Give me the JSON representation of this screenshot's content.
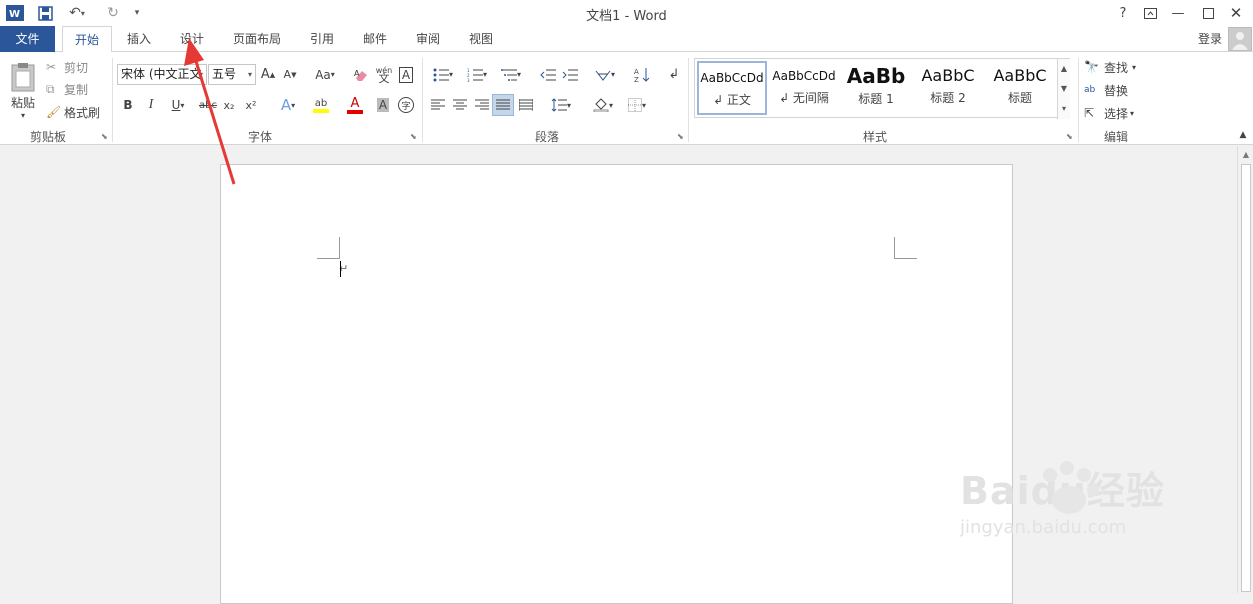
{
  "app": {
    "title": "文档1 - Word",
    "help_icon": "?",
    "login_label": "登录"
  },
  "tabs": {
    "file": "文件",
    "home": "开始",
    "insert": "插入",
    "design": "设计",
    "layout": "页面布局",
    "references": "引用",
    "mailings": "邮件",
    "review": "审阅",
    "view": "视图"
  },
  "clipboard": {
    "paste": "粘贴",
    "cut": "剪切",
    "copy": "复制",
    "format_painter": "格式刷",
    "group_label": "剪贴板"
  },
  "font": {
    "font_name": "宋体 (中文正文",
    "font_size": "五号",
    "group_label": "字体",
    "bold": "B",
    "italic": "I",
    "underline": "U",
    "strike": "abc",
    "subscript": "x₂",
    "superscript": "x²",
    "change_case": "Aa",
    "grow": "A",
    "shrink": "A",
    "phonetic": "wén",
    "char_border": "A",
    "highlight": "ab",
    "font_color": "A",
    "char_shading": "A",
    "enclose": "字"
  },
  "paragraph": {
    "group_label": "段落"
  },
  "styles": {
    "group_label": "样式",
    "items": [
      {
        "sample": "AaBbCcDd",
        "name": "↲ 正文"
      },
      {
        "sample": "AaBbCcDd",
        "name": "↲ 无间隔"
      },
      {
        "sample": "AaBb",
        "name": "标题 1"
      },
      {
        "sample": "AaBbC",
        "name": "标题 2"
      },
      {
        "sample": "AaBbC",
        "name": "标题"
      }
    ]
  },
  "editing": {
    "find": "查找",
    "replace": "替换",
    "select": "选择",
    "group_label": "编辑"
  },
  "document": {
    "paragraph_mark": "↵"
  },
  "watermark": {
    "brand": "Baidu经验",
    "url": "jingyan.baidu.com"
  },
  "colors": {
    "accent": "#2b579a",
    "arrow": "#e53935"
  }
}
